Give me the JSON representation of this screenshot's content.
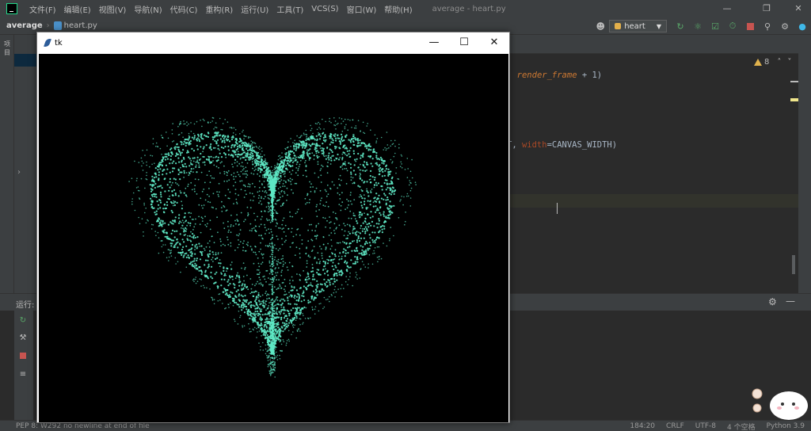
{
  "menubar": {
    "items": [
      "文件(F)",
      "编辑(E)",
      "视图(V)",
      "导航(N)",
      "代码(C)",
      "重构(R)",
      "运行(U)",
      "工具(T)",
      "VCS(S)",
      "窗口(W)",
      "帮助(H)"
    ],
    "window_title": "average - heart.py"
  },
  "toolbar": {
    "project": "average",
    "file": "heart.py",
    "run_config": "heart"
  },
  "editor": {
    "inspection_count": "8",
    "line1_tail": ", ",
    "line1_italic": "render_frame",
    "line1_rest": " + 1)",
    "line2_tail": "T, ",
    "line2_param": "width",
    "line2_rest": "=CANVAS_WIDTH)"
  },
  "run_panel": {
    "label": "运行:"
  },
  "statusbar": {
    "message": "PEP 8: W292 no newline at end of file",
    "position": "184:20",
    "line_sep": "CRLF",
    "encoding": "UTF-8",
    "indent": "4 个空格",
    "interpreter": "Python 3.9"
  },
  "tk_window": {
    "title": "tk"
  },
  "colors": {
    "particle": "#5ee8c4",
    "ide_bg": "#2b2b2b",
    "panel_bg": "#3c3f41"
  }
}
